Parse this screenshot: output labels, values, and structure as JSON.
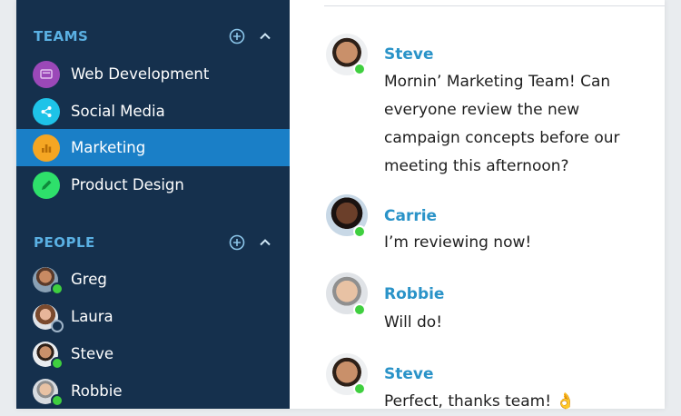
{
  "sidebar": {
    "teams": {
      "title": "TEAMS",
      "items": [
        {
          "label": "Web Development",
          "icon": "web-dev-icon",
          "color": "#9b48b8"
        },
        {
          "label": "Social Media",
          "icon": "share-icon",
          "color": "#1ec3e8"
        },
        {
          "label": "Marketing",
          "icon": "bar-chart-icon",
          "color": "#f5a623",
          "active": true
        },
        {
          "label": "Product Design",
          "icon": "pencil-icon",
          "color": "#2ee06b"
        }
      ]
    },
    "people": {
      "title": "PEOPLE",
      "items": [
        {
          "label": "Greg",
          "status": "online"
        },
        {
          "label": "Laura",
          "status": "offline"
        },
        {
          "label": "Steve",
          "status": "online"
        },
        {
          "label": "Robbie",
          "status": "online"
        }
      ]
    }
  },
  "messages": [
    {
      "author": "Steve",
      "text": "Mornin’ Marketing Team! Can everyone review the new campaign concepts before our meeting this afternoon?"
    },
    {
      "author": "Carrie",
      "text": "I’m reviewing now!"
    },
    {
      "author": "Robbie",
      "text": "Will do!"
    },
    {
      "author": "Steve",
      "text": "Perfect, thanks team!",
      "emoji": "👌"
    }
  ],
  "colors": {
    "sidebar_bg": "#15304d",
    "active_item": "#1a7fc7",
    "section_title": "#5ab0e3",
    "author_name": "#2a93c8",
    "online": "#3fcf3f"
  }
}
